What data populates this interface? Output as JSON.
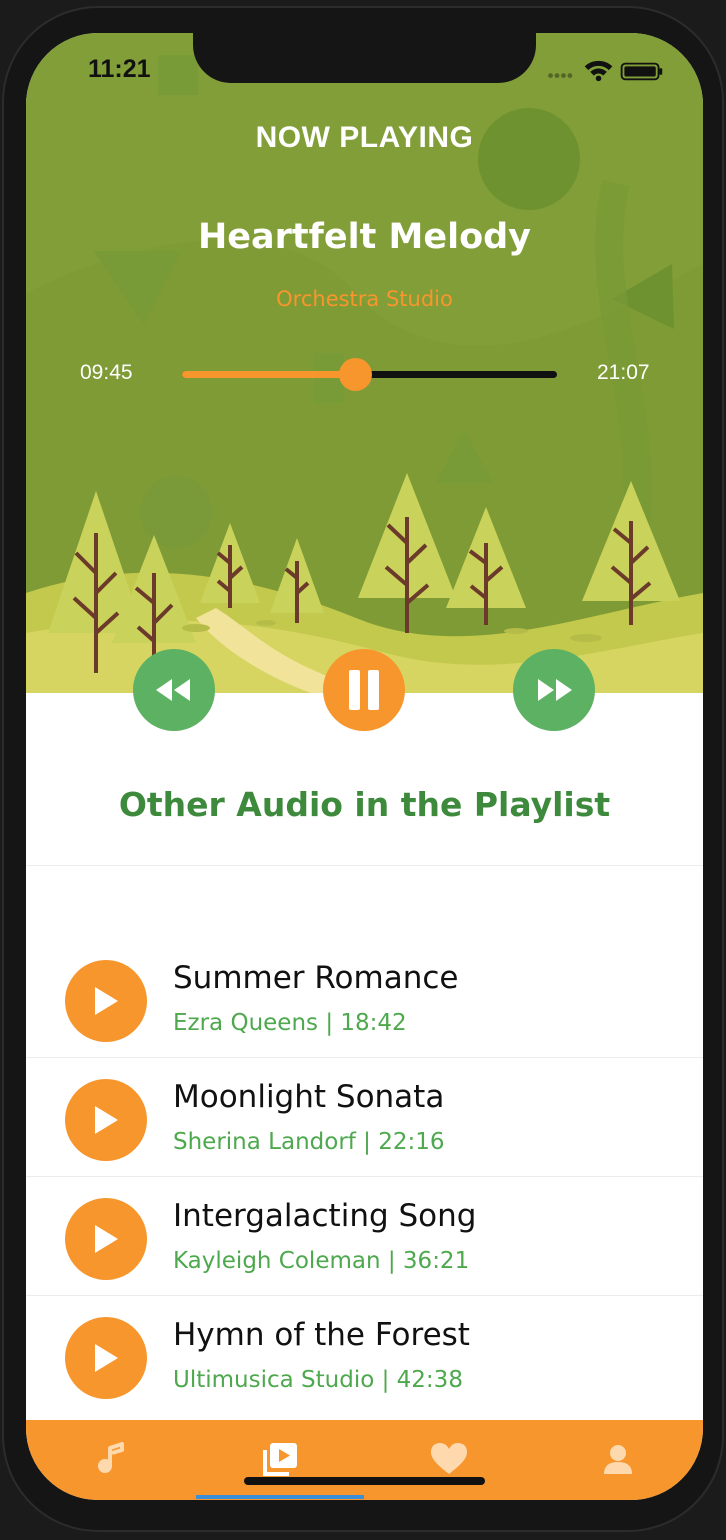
{
  "status_bar": {
    "time": "11:21"
  },
  "now_playing": {
    "label": "NOW PLAYING",
    "title": "Heartfelt Melody",
    "artist": "Orchestra Studio",
    "elapsed": "09:45",
    "total": "21:07",
    "progress_fraction": 0.46
  },
  "controls": {
    "rewind_icon": "rewind-icon",
    "pause_icon": "pause-icon",
    "forward_icon": "fast-forward-icon"
  },
  "playlist": {
    "heading": "Other Audio in the Playlist",
    "items": [
      {
        "title": "Summer Romance",
        "meta": "Ezra Queens | 18:42"
      },
      {
        "title": "Moonlight Sonata",
        "meta": "Sherina Landorf | 22:16"
      },
      {
        "title": "Intergalacting Song",
        "meta": "Kayleigh Coleman | 36:21"
      },
      {
        "title": "Hymn of the Forest",
        "meta": "Ultimusica Studio | 42:38"
      }
    ]
  },
  "tab_bar": {
    "tabs": [
      {
        "icon": "music-note-icon"
      },
      {
        "icon": "playlist-play-icon",
        "active": true
      },
      {
        "icon": "heart-icon"
      },
      {
        "icon": "person-icon"
      }
    ]
  },
  "colors": {
    "accent_orange": "#f7962d",
    "hero_green": "#7f9b35",
    "button_green": "#5cb162",
    "text_green": "#3e8a3c",
    "active_tab_indicator": "#3b8fd8"
  }
}
